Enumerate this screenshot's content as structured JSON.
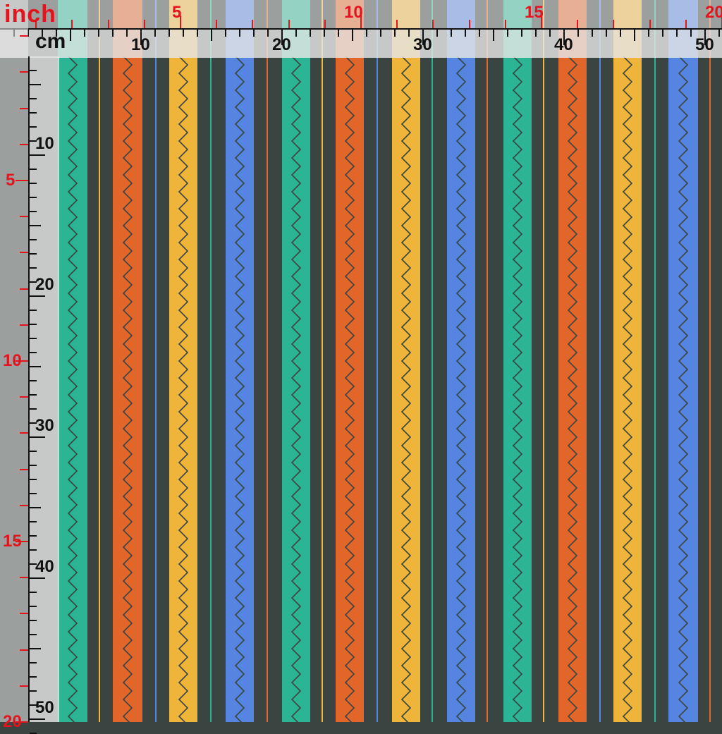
{
  "rulers": {
    "inch_label": "inch",
    "cm_label": "cm",
    "top_inch_ticks": [
      "5",
      "10",
      "15",
      "20"
    ],
    "top_cm_ticks": [
      "10",
      "20",
      "30",
      "40",
      "50"
    ],
    "left_inch_ticks": [
      "5",
      "10",
      "15",
      "20"
    ],
    "left_cm_ticks": [
      "10",
      "20",
      "30",
      "40",
      "50"
    ],
    "inch_color": "#e2151f",
    "cm_color": "#111111"
  },
  "fabric": {
    "pattern": "vertical stripes with zigzag stitching",
    "colors": {
      "charcoal": "#3a4441",
      "teal": "#2bb594",
      "orange": "#e2662a",
      "yellow": "#efb43a",
      "blue": "#5585e0",
      "zigzag": "#3a4441"
    }
  }
}
